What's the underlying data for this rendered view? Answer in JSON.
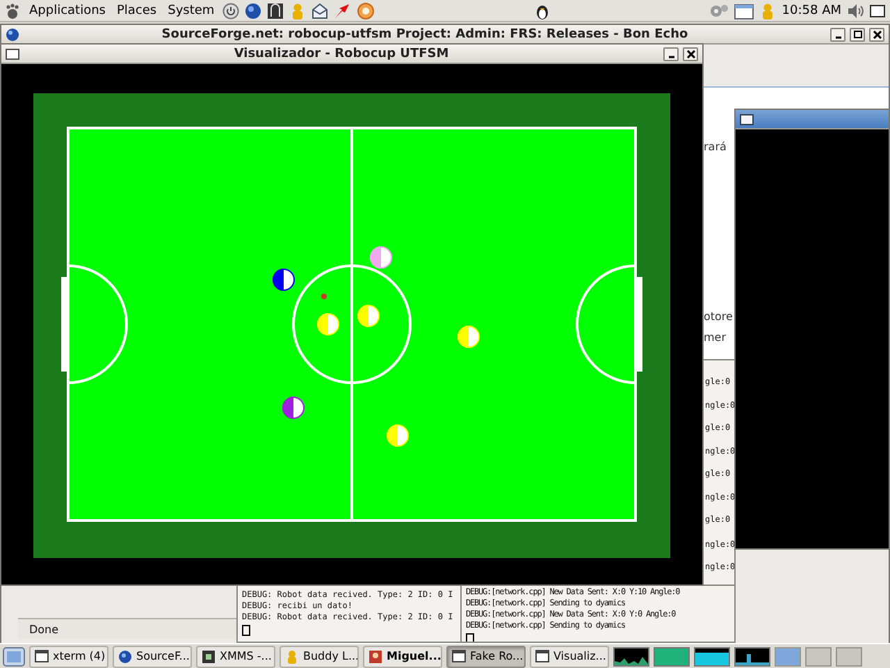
{
  "top_panel": {
    "menus": [
      "Applications",
      "Places",
      "System"
    ],
    "clock": "10:58 AM"
  },
  "browser_window": {
    "title": "SourceForge.net: robocup-utfsm Project: Admin: FRS: Releases - Bon Echo",
    "content_fragments": [
      "rará",
      "otore",
      "mer"
    ],
    "status": "Done"
  },
  "visualizer_window": {
    "title": "Visualizador - Robocup UTFSM",
    "robots": [
      {
        "color": "#0000ee"
      },
      {
        "color": "#f0a8f0"
      },
      {
        "color": "#ffff00"
      },
      {
        "color": "#ffff00"
      },
      {
        "color": "#ffff00"
      },
      {
        "color": "#a020e0"
      },
      {
        "color": "#ffff00"
      }
    ]
  },
  "terminal_left": {
    "lines": [
      "DEBUG: Robot data recived. Type: 2 ID: 0 I",
      "DEBUG: recibi un dato!",
      "DEBUG: Robot data recived. Type: 2 ID: 0 I"
    ]
  },
  "terminal_right": {
    "line_ends": [
      "gle:0",
      "ngle:0",
      "gle:0",
      "ngle:0",
      "gle:0",
      "ngle:0",
      "gle:0",
      "ngle:0",
      "ngle:0"
    ],
    "lines": [
      "DEBUG:[network.cpp] New Data Sent: X:0 Y:10 Angle:0",
      "DEBUG:[network.cpp] Sending to dyamics",
      "DEBUG:[network.cpp] New Data Sent: X:0 Y:0 Angle:0",
      "DEBUG:[network.cpp] Sending to dyamics"
    ]
  },
  "taskbar": {
    "tasks": [
      {
        "label": "xterm (4)",
        "kind": "terminal",
        "selected": false,
        "urgent": false
      },
      {
        "label": "SourceF...",
        "kind": "browser",
        "selected": false,
        "urgent": false
      },
      {
        "label": "XMMS -...",
        "kind": "player",
        "selected": false,
        "urgent": false
      },
      {
        "label": "Buddy L...",
        "kind": "chat",
        "selected": false,
        "urgent": false
      },
      {
        "label": "Miguel...",
        "kind": "chat-window",
        "selected": false,
        "urgent": true
      },
      {
        "label": "Fake Ro...",
        "kind": "terminal",
        "selected": true,
        "urgent": false
      },
      {
        "label": "Visualiz...",
        "kind": "terminal",
        "selected": false,
        "urgent": false
      }
    ]
  }
}
